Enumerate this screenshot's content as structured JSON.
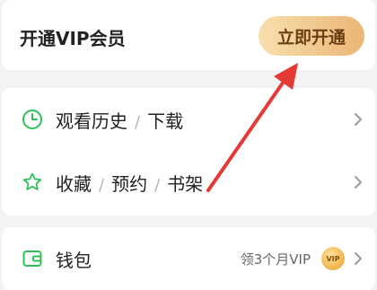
{
  "vip": {
    "title": "开通VIP会员",
    "button_label": "立即开通"
  },
  "menu": {
    "row1": {
      "items": [
        "观看历史",
        "下载"
      ],
      "icon": "clock-icon",
      "separator": "/"
    },
    "row2": {
      "items": [
        "收藏",
        "预约",
        "书架"
      ],
      "icon": "star-icon",
      "separator": "/"
    }
  },
  "wallet": {
    "label": "钱包",
    "promo_text": "领3个月VIP",
    "badge_text": "VIP",
    "icon": "wallet-icon"
  },
  "colors": {
    "accent_green": "#2fbf57",
    "vip_gold_start": "#f8dfae",
    "vip_gold_end": "#e9b675",
    "annotation_red": "#e53935"
  }
}
